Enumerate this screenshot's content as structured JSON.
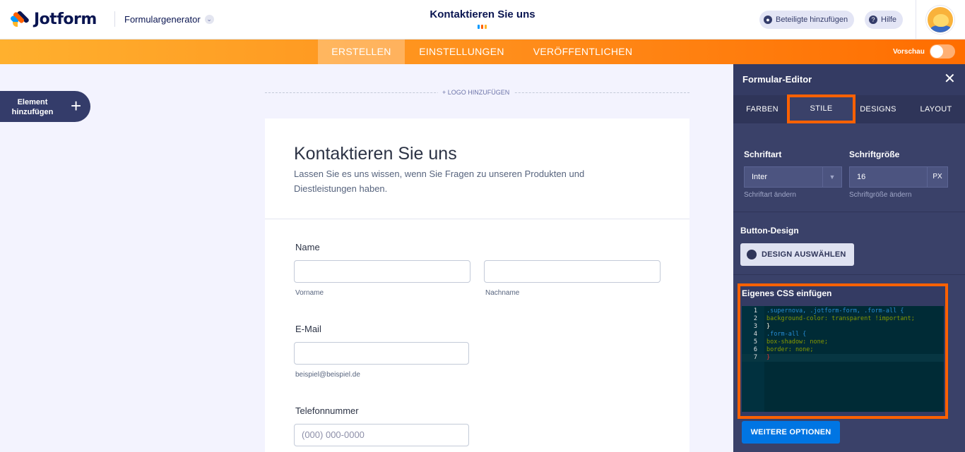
{
  "header": {
    "logo_text": "Jotform",
    "generator_label": "Formulargenerator",
    "form_title": "Kontaktieren Sie uns",
    "add_participants": "Beteiligte hinzufügen",
    "help": "Hilfe"
  },
  "nav": {
    "tabs": [
      {
        "label": "ERSTELLEN",
        "active": true
      },
      {
        "label": "EINSTELLUNGEN",
        "active": false
      },
      {
        "label": "VERÖFFENTLICHEN",
        "active": false
      }
    ],
    "preview_label": "Vorschau",
    "preview_on": false
  },
  "left": {
    "add_element_label": "Element hinzufügen"
  },
  "canvas": {
    "add_logo": "+ LOGO HINZUFÜGEN",
    "form_title": "Kontaktieren Sie uns",
    "form_description": "Lassen Sie es uns wissen, wenn Sie Fragen zu unseren Produkten und Diestleistungen haben.",
    "fields": {
      "name_label": "Name",
      "first_name_sublabel": "Vorname",
      "last_name_sublabel": "Nachname",
      "email_label": "E-Mail",
      "email_sublabel": "beispiel@beispiel.de",
      "phone_label": "Telefonnummer",
      "phone_placeholder": "(000) 000-0000"
    }
  },
  "panel": {
    "title": "Formular-Editor",
    "tabs": [
      {
        "label": "FARBEN",
        "active": false
      },
      {
        "label": "STILE",
        "active": true
      },
      {
        "label": "DESIGNS",
        "active": false
      },
      {
        "label": "LAYOUT",
        "active": false
      }
    ],
    "font_label": "Schriftart",
    "font_value": "Inter",
    "font_note": "Schriftart ändern",
    "size_label": "Schriftgröße",
    "size_value": "16",
    "size_unit": "PX",
    "size_note": "Schriftgröße ändern",
    "button_design_label": "Button-Design",
    "design_button": "DESIGN AUSWÄHLEN",
    "css_label": "Eigenes CSS einfügen",
    "css_lines": [
      ".supernova, .jotform-form, .form-all {",
      "background-color: transparent !important;",
      "}",
      ".form-all {",
      "box-shadow: none;",
      "border: none;",
      "}"
    ],
    "more_options": "WEITERE OPTIONEN"
  },
  "colors": {
    "brand_orange": "#ff6100",
    "brand_navy": "#0a1551",
    "panel_bg": "#3a4169",
    "primary_blue": "#0075e3"
  }
}
